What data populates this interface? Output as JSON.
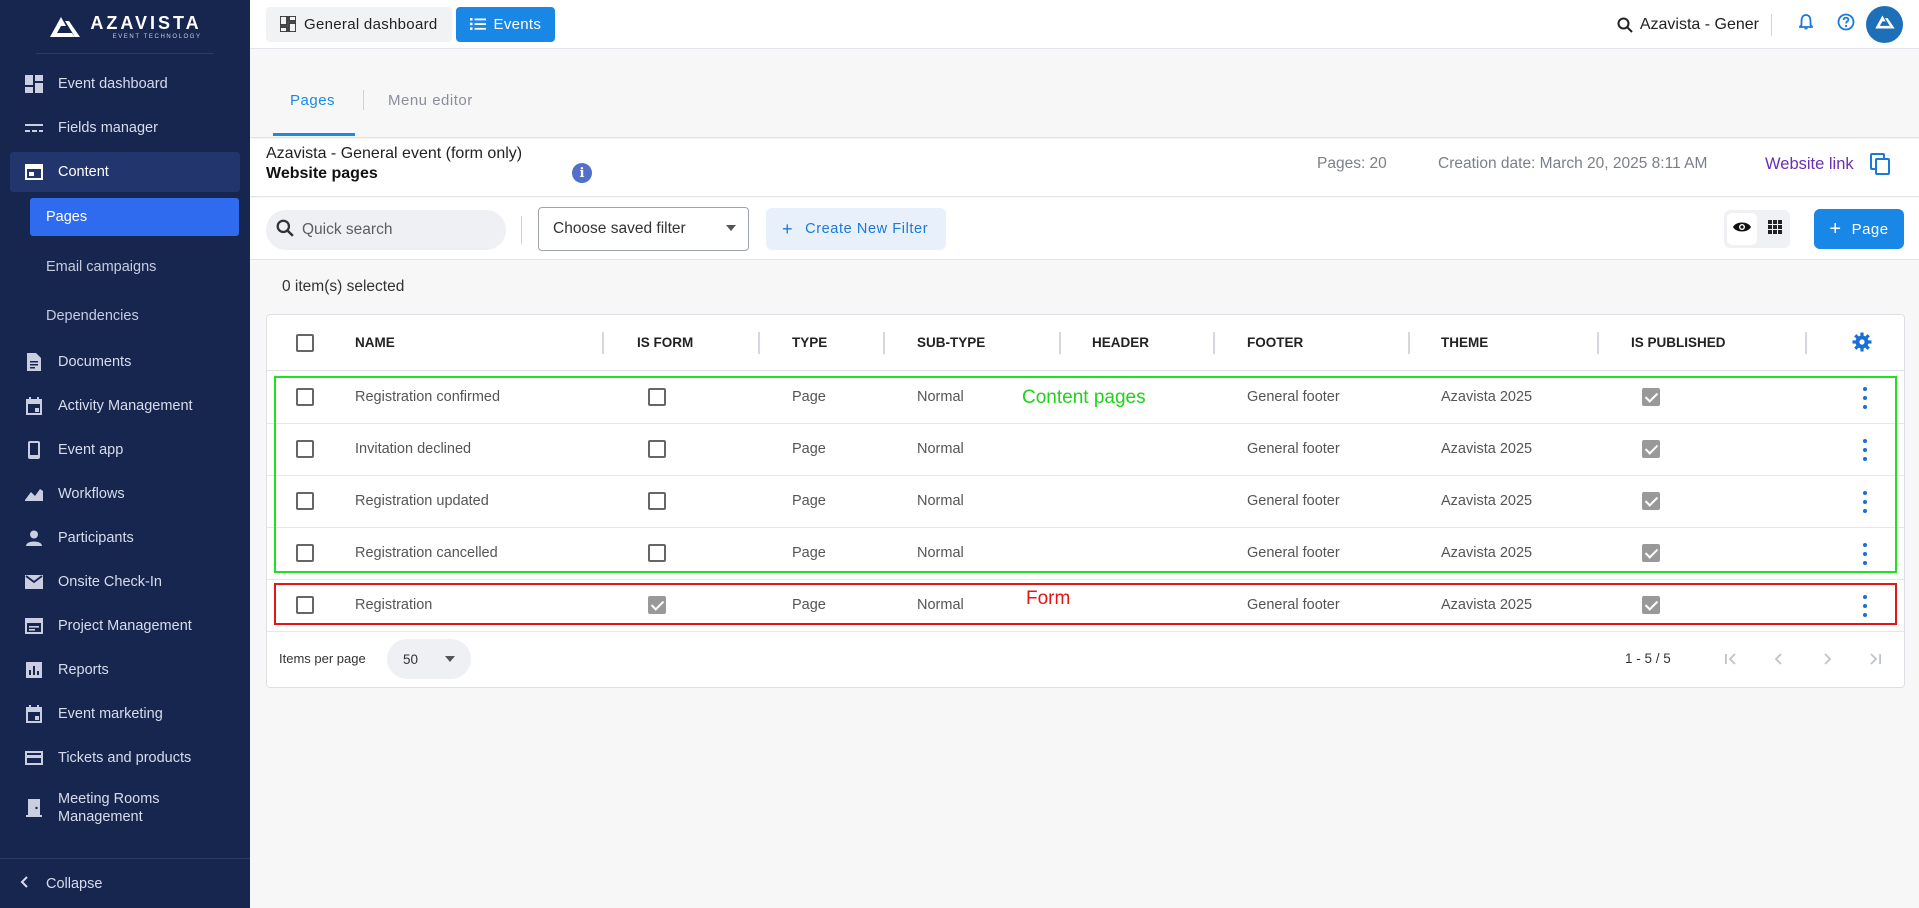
{
  "logo": {
    "name": "AZAVISTA",
    "sub": "EVENT TECHNOLOGY"
  },
  "sidebar": {
    "items": [
      {
        "label": "Event dashboard"
      },
      {
        "label": "Fields manager"
      },
      {
        "label": "Content"
      },
      {
        "label": "Pages"
      },
      {
        "label": "Email campaigns"
      },
      {
        "label": "Dependencies"
      },
      {
        "label": "Documents"
      },
      {
        "label": "Activity Management"
      },
      {
        "label": "Event app"
      },
      {
        "label": "Workflows"
      },
      {
        "label": "Participants"
      },
      {
        "label": "Onsite Check-In"
      },
      {
        "label": "Project Management"
      },
      {
        "label": "Reports"
      },
      {
        "label": "Event marketing"
      },
      {
        "label": "Tickets and products"
      },
      {
        "label": "Meeting Rooms Management"
      }
    ],
    "collapse_label": "Collapse"
  },
  "topbar": {
    "dashboard_label": "General dashboard",
    "events_label": "Events",
    "search_text": "Azavista - Gener"
  },
  "tabs": {
    "pages": "Pages",
    "menu_editor": "Menu editor"
  },
  "info": {
    "event_name": "Azavista - General event (form only)",
    "section_title": "Website pages",
    "pages_count": "Pages: 20",
    "creation_date": "Creation date: March 20, 2025 8:11 AM",
    "website_link": "Website link"
  },
  "toolbar": {
    "search_placeholder": "Quick search",
    "saved_filter": "Choose saved filter",
    "create_filter": "Create New Filter",
    "add_page": "Page"
  },
  "selection": {
    "text": "0 item(s) selected"
  },
  "table": {
    "columns": [
      "NAME",
      "IS FORM",
      "TYPE",
      "SUB-TYPE",
      "HEADER",
      "FOOTER",
      "THEME",
      "IS PUBLISHED"
    ],
    "rows": [
      {
        "name": "Registration confirmed",
        "is_form": false,
        "type": "Page",
        "subtype": "Normal",
        "header": "",
        "footer": "General footer",
        "theme": "Azavista 2025",
        "published": true
      },
      {
        "name": "Invitation declined",
        "is_form": false,
        "type": "Page",
        "subtype": "Normal",
        "header": "",
        "footer": "General footer",
        "theme": "Azavista 2025",
        "published": true
      },
      {
        "name": "Registration updated",
        "is_form": false,
        "type": "Page",
        "subtype": "Normal",
        "header": "",
        "footer": "General footer",
        "theme": "Azavista 2025",
        "published": true
      },
      {
        "name": "Registration cancelled",
        "is_form": false,
        "type": "Page",
        "subtype": "Normal",
        "header": "",
        "footer": "General footer",
        "theme": "Azavista 2025",
        "published": true
      },
      {
        "name": "Registration",
        "is_form": true,
        "type": "Page",
        "subtype": "Normal",
        "header": "",
        "footer": "General footer",
        "theme": "Azavista 2025",
        "published": true
      }
    ]
  },
  "annotations": {
    "content_pages": "Content pages",
    "form": "Form"
  },
  "pagination": {
    "items_per_page_label": "Items per page",
    "items_per_page": "50",
    "range": "1 - 5 / 5"
  },
  "colors": {
    "sidebar_bg": "#17264f",
    "accent": "#1987e6",
    "annotation_green": "#22e01f",
    "annotation_red": "#e31515"
  }
}
